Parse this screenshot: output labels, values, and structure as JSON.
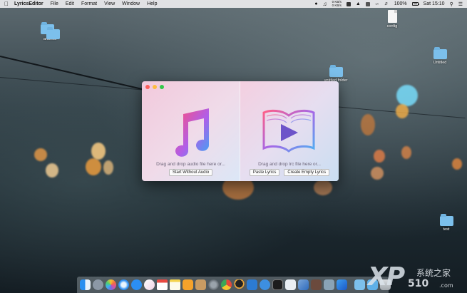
{
  "menubar": {
    "app_name": "LyricsEditor",
    "menus": [
      "File",
      "Edit",
      "Format",
      "View",
      "Window",
      "Help"
    ],
    "net_up": "0 KB/s",
    "net_down": "0 KB/s",
    "battery": "100%",
    "clock": "Sat 15:10"
  },
  "desktop": {
    "icons": [
      {
        "label": "android",
        "kind": "folder-icon"
      },
      {
        "label": "config",
        "kind": "file-icon"
      },
      {
        "label": "Untitled",
        "kind": "folder-icon"
      },
      {
        "label": "untitled folder",
        "kind": "folder-icon"
      },
      {
        "label": "test",
        "kind": "folder-icon"
      }
    ]
  },
  "window": {
    "audio_pane": {
      "drop_text": "Drag and drop audio file here or...",
      "start_button": "Start Without Audio"
    },
    "lyrics_pane": {
      "drop_text": "Drag and drop lrc file here or...",
      "paste_button": "Paste Lyrics",
      "create_button": "Create Empty Lyrics"
    }
  },
  "dock": {
    "apps": [
      "finder-icon",
      "launchpad-icon",
      "photos-icon",
      "safari-icon",
      "app-store-icon",
      "music-icon",
      "calendar-icon",
      "notes-icon",
      "books-icon",
      "contacts-icon",
      "system-preferences-icon",
      "chrome-icon",
      "qq-icon",
      "vscode-icon",
      "xcode-icon",
      "terminal-icon",
      "preview-icon",
      "pages-icon",
      "photo-booth-icon",
      "image-capture-icon",
      "lyrics-editor-icon",
      "folder-icon",
      "downloads-icon",
      "trash-icon"
    ]
  },
  "watermark": {
    "big": "XP",
    "site_name": "系统之家",
    "number": "510",
    "suffix": ".com"
  },
  "colors": {
    "window_pink": "#f2c9dc",
    "window_blue": "#d5e5f4",
    "close": "#fc605c",
    "minimize": "#fdbc40",
    "zoom": "#34c84a"
  }
}
